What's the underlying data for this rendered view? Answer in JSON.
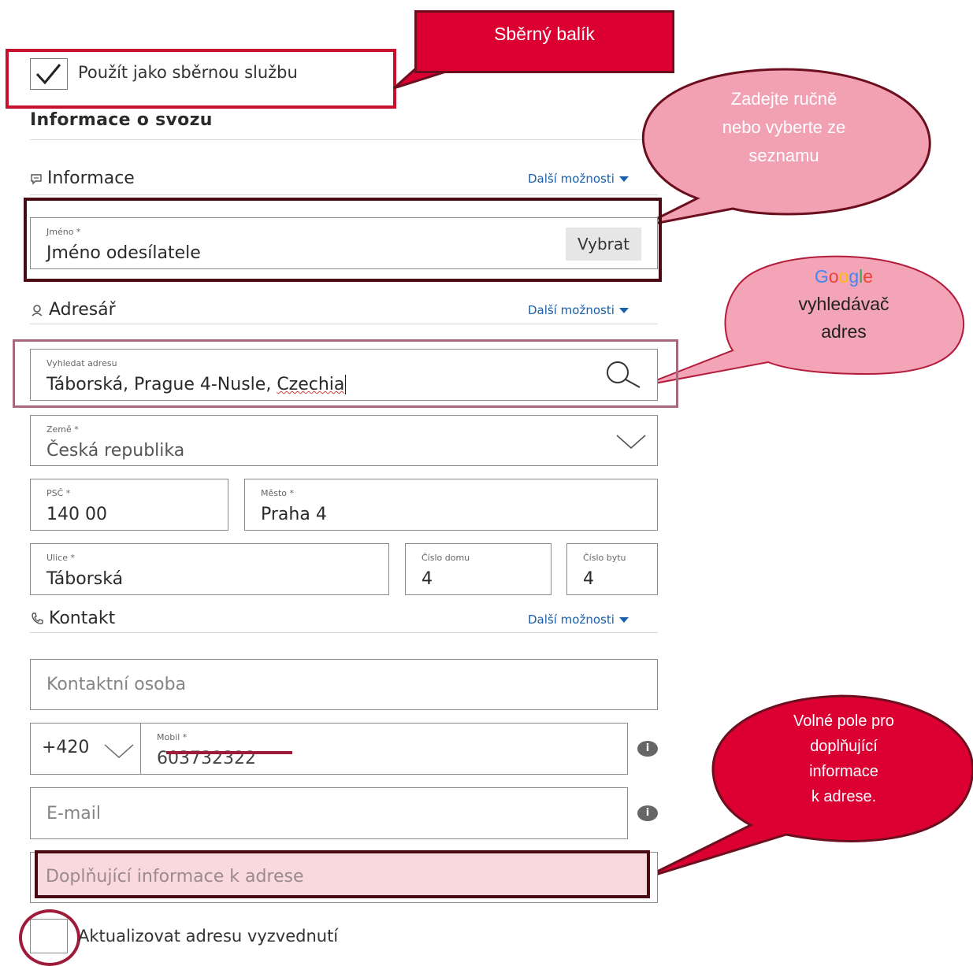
{
  "callouts": {
    "collect_parcel": "Sběrný balík",
    "manual_entry": [
      "Zadejte ručně",
      "nebo vyberte ze",
      "seznamu"
    ],
    "google_logo": "Google",
    "google_text": [
      "vyhledávač",
      "adres"
    ],
    "free_field": [
      "Volné pole pro",
      "doplňující",
      "informace",
      "k adrese."
    ]
  },
  "collect_service": {
    "label": "Použít jako sběrnou službu",
    "checked": true
  },
  "pickup": {
    "title": "Informace o svozu",
    "info": {
      "title": "Informace",
      "more": "Další možnosti",
      "name_label": "Jméno *",
      "name_value": "Jméno odesílatele",
      "select_button": "Vybrat"
    },
    "address": {
      "title": "Adresář",
      "more": "Další možnosti",
      "search_label": "Vyhledat adresu",
      "search_value_main": "Táborská, Prague 4-Nusle, ",
      "search_value_tail": "Czechia",
      "country_label": "Země *",
      "country_value": "Česká republika",
      "zip_label": "PSČ *",
      "zip_value": "140 00",
      "city_label": "Město *",
      "city_value": "Praha 4",
      "street_label": "Ulice *",
      "street_value": "Táborská",
      "house_label": "Číslo domu",
      "house_value": "4",
      "flat_label": "Číslo bytu",
      "flat_value": "4"
    },
    "contact": {
      "title": "Kontakt",
      "more": "Další možnosti",
      "person_placeholder": "Kontaktní osoba",
      "prefix": "+420",
      "mobile_label": "Mobil *",
      "mobile_value": "603732322",
      "email_placeholder": "E-mail",
      "additional_placeholder": "Doplňující informace k adrese"
    },
    "update_address": {
      "label": "Aktualizovat adresu vyzvednutí",
      "checked": false
    }
  },
  "colors": {
    "brand_red": "#dc0032",
    "callout_pink": "#f4a6b4",
    "link_blue": "#1a5fa8",
    "highlight_border": "#6b0f1f"
  }
}
